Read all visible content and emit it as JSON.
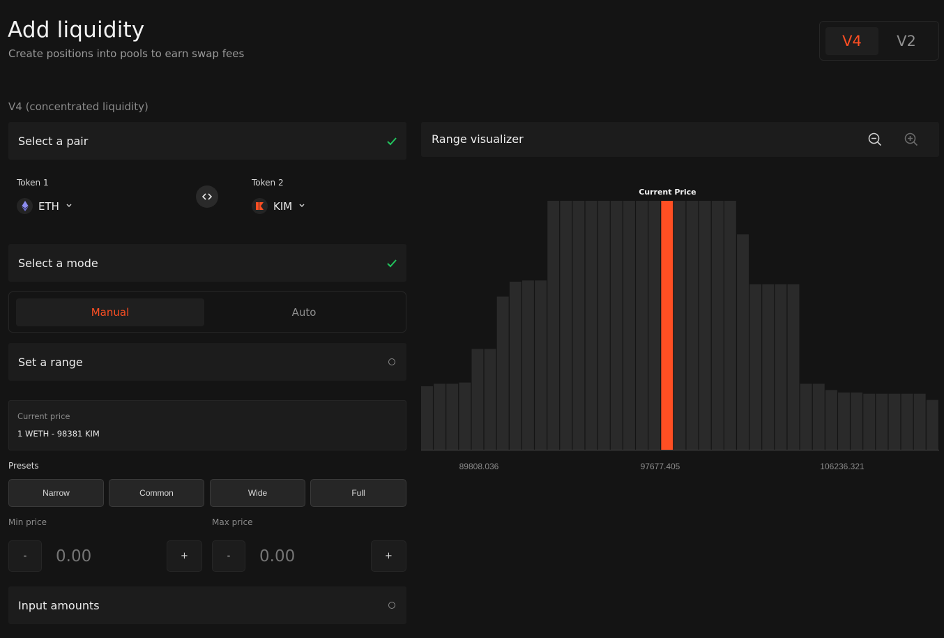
{
  "header": {
    "title": "Add liquidity",
    "subtitle": "Create positions into pools to earn swap fees"
  },
  "version_toggle": {
    "active": "V4",
    "inactive": "V2"
  },
  "section_label": "V4 (concentrated liquidity)",
  "steps": {
    "select_pair": "Select a pair",
    "select_mode": "Select a mode",
    "set_range": "Set a range",
    "input_amounts": "Input amounts"
  },
  "tokens": {
    "token1_label": "Token 1",
    "token1_symbol": "ETH",
    "token1_icon": "ethereum-icon",
    "token2_label": "Token 2",
    "token2_symbol": "KIM",
    "token2_icon": "kim-logo-icon"
  },
  "mode": {
    "manual": "Manual",
    "auto": "Auto",
    "active": "Manual"
  },
  "current_price": {
    "label": "Current price",
    "value": "1 WETH - 98381 KIM"
  },
  "presets": {
    "label": "Presets",
    "items": [
      "Narrow",
      "Common",
      "Wide",
      "Full"
    ]
  },
  "min_price": {
    "label": "Min price",
    "placeholder": "0.00",
    "minus": "-",
    "plus": "+"
  },
  "max_price": {
    "label": "Max price",
    "placeholder": "0.00",
    "minus": "-",
    "plus": "+"
  },
  "visualizer": {
    "title": "Range visualizer",
    "zoom_out_icon": "zoom-out-icon",
    "zoom_in_icon": "zoom-in-icon"
  },
  "colors": {
    "accent": "#ff4f23",
    "success": "#22c55e",
    "bar": "#2a2a2a",
    "background": "#141414",
    "panel": "#1c1c1c"
  },
  "chart_data": {
    "type": "bar",
    "current_price_label": "Current Price",
    "current_index": 19,
    "values": [
      51,
      53,
      53,
      54,
      81,
      81,
      123,
      135,
      136,
      136,
      200,
      200,
      200,
      200,
      200,
      200,
      200,
      200,
      200,
      200,
      200,
      200,
      200,
      200,
      200,
      173,
      133,
      133,
      133,
      133,
      53,
      53,
      48,
      46,
      46,
      45,
      45,
      45,
      45,
      45,
      40
    ],
    "x_ticks": [
      "89808.036",
      "97677.405",
      "106236.321"
    ],
    "ylim": [
      0,
      200
    ]
  }
}
